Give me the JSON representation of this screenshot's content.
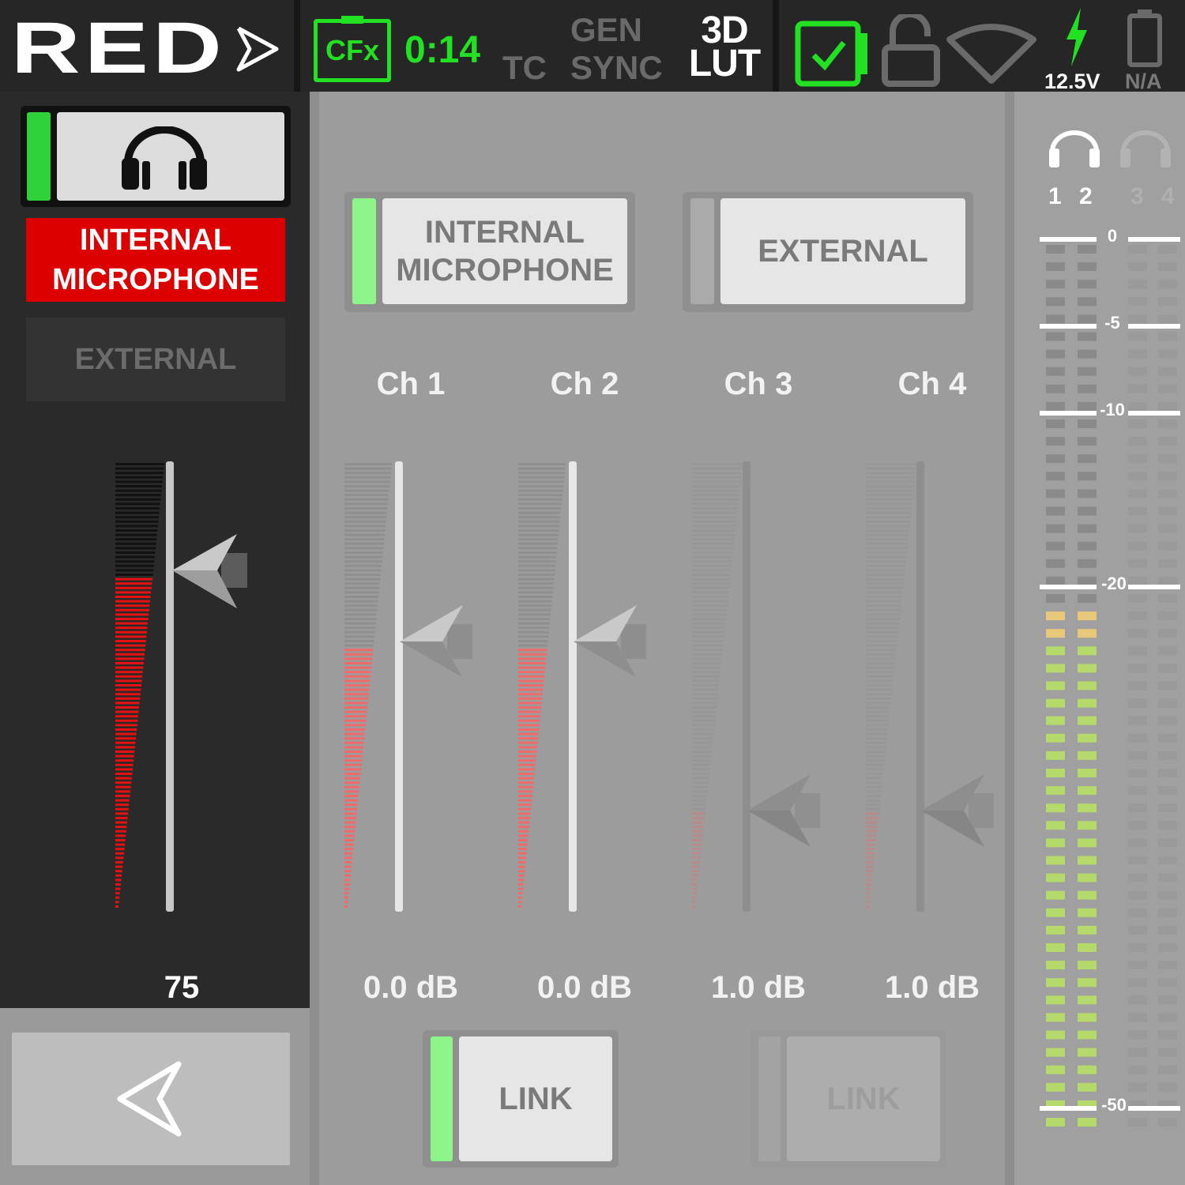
{
  "status_bar": {
    "brand": "RED",
    "media": "CFx",
    "record_time": "0:14",
    "tc": "TC",
    "gen": "GEN",
    "sync": "SYNC",
    "lut_top": "3D",
    "lut_bottom": "LUT",
    "voltage": "12.5V",
    "battery_status": "N/A",
    "colors": {
      "active_green": "#22e022",
      "inactive_gray": "#6a6a6a"
    }
  },
  "left_panel": {
    "source_internal": "INTERNAL MICROPHONE",
    "source_external": "EXTERNAL",
    "headphone_volume": "75",
    "headphone_level_fraction": 0.75,
    "colors": {
      "selected_source": "#dd0000"
    }
  },
  "inputs": {
    "internal_label": "INTERNAL MICROPHONE",
    "external_label": "EXTERNAL",
    "channels": [
      {
        "label": "Ch 1",
        "gain": "0.0 dB",
        "active": true
      },
      {
        "label": "Ch 2",
        "gain": "0.0 dB",
        "active": true
      },
      {
        "label": "Ch 3",
        "gain": "1.0 dB",
        "active": false
      },
      {
        "label": "Ch 4",
        "gain": "1.0 dB",
        "active": false
      }
    ],
    "link_labels": [
      "LINK",
      "LINK"
    ]
  },
  "meter": {
    "channels": [
      "1",
      "2",
      "3",
      "4"
    ],
    "scale": [
      "0",
      "-5",
      "-10",
      "-20",
      "-50"
    ],
    "level_db": -21,
    "colors": {
      "level": "#b5d96a",
      "peak": "#e8c97a"
    }
  }
}
